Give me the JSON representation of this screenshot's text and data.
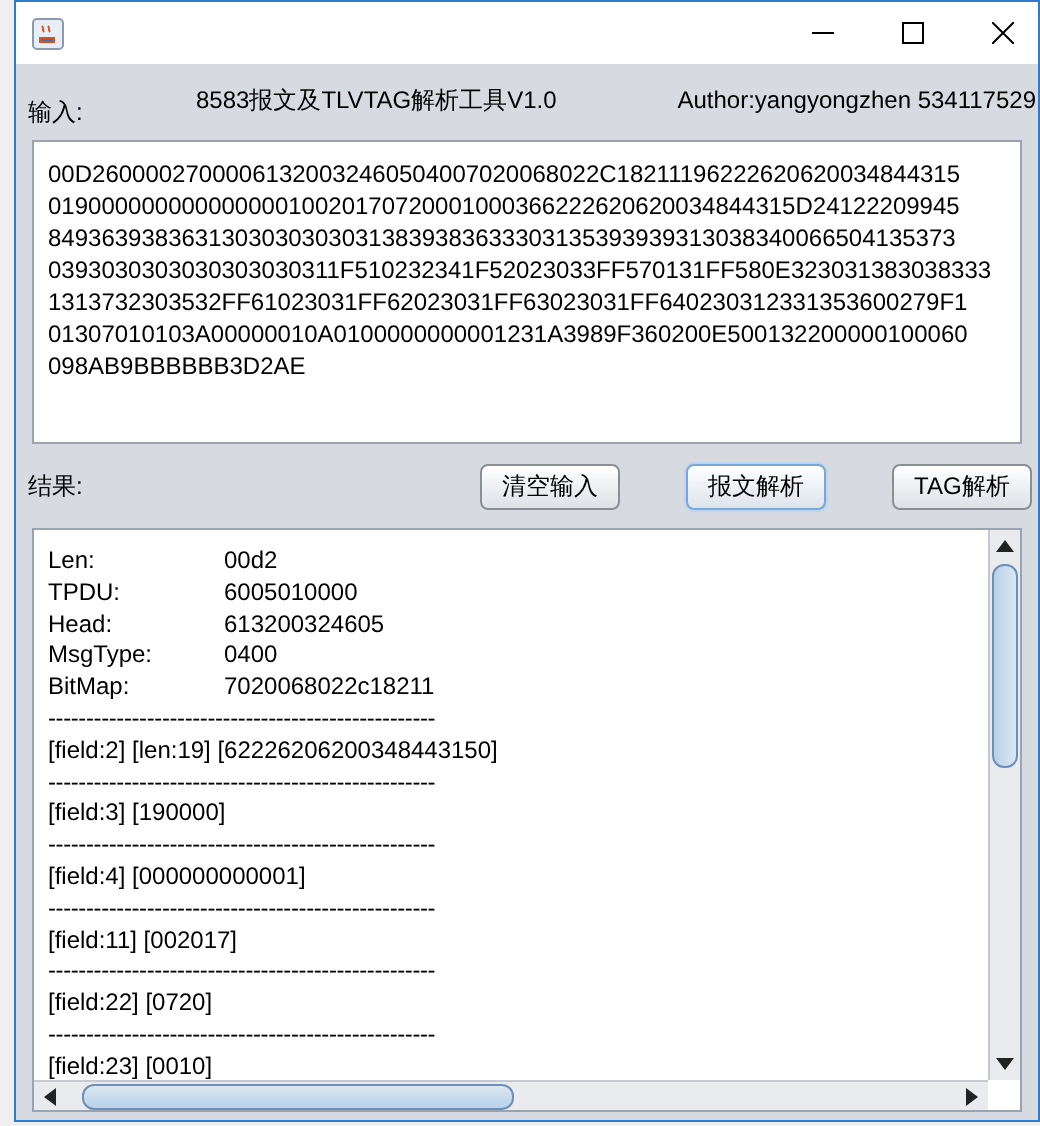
{
  "window": {
    "title": "8583报文及TLVTAG解析工具V1.0",
    "author": "Author:yangyongzhen 534117529"
  },
  "input": {
    "label": "输入:",
    "value": "00D26000027000061320032460504007020068022C18211196222620620034844315\n01900000000000000010020170720001000366222620620034844315D24122209945\n84936393836313030303030313839383633303135393939313038340066504135373\n0393030303030303030311F510232341F52023033FF570131FF580E323031383038333\n1313732303532FF61023031FF62023031FF63023031FF640230312331353600279F1\n01307010103A00000010A0100000000001231A3989F360200E500132200000100060\n098AB9BBBBBB3D2AE"
  },
  "result_label": "结果:",
  "buttons": [
    {
      "label": "清空输入",
      "focused": false
    },
    {
      "label": "报文解析",
      "focused": true
    },
    {
      "label": "TAG解析",
      "focused": false
    }
  ],
  "result": [
    {
      "kind": "pair",
      "label": "Len:",
      "value": "00d2"
    },
    {
      "kind": "pair",
      "label": "TPDU:",
      "value": "6005010000"
    },
    {
      "kind": "pair",
      "label": "Head:",
      "value": "613200324605"
    },
    {
      "kind": "pair",
      "label": "MsgType:",
      "value": "0400"
    },
    {
      "kind": "pair",
      "label": "BitMap:",
      "value": "7020068022c18211"
    },
    {
      "kind": "separator",
      "text": "---------------------------------------------------"
    },
    {
      "kind": "line",
      "text": "[field:2] [len:19] [62226206200348443150]"
    },
    {
      "kind": "separator",
      "text": "---------------------------------------------------"
    },
    {
      "kind": "line",
      "text": "[field:3] [190000]"
    },
    {
      "kind": "separator",
      "text": "---------------------------------------------------"
    },
    {
      "kind": "line",
      "text": "[field:4] [000000000001]"
    },
    {
      "kind": "separator",
      "text": "---------------------------------------------------"
    },
    {
      "kind": "line",
      "text": "[field:11] [002017]"
    },
    {
      "kind": "separator",
      "text": "---------------------------------------------------"
    },
    {
      "kind": "line",
      "text": "[field:22] [0720]"
    },
    {
      "kind": "separator",
      "text": "---------------------------------------------------"
    },
    {
      "kind": "line",
      "text": "[field:23] [0010]"
    }
  ]
}
